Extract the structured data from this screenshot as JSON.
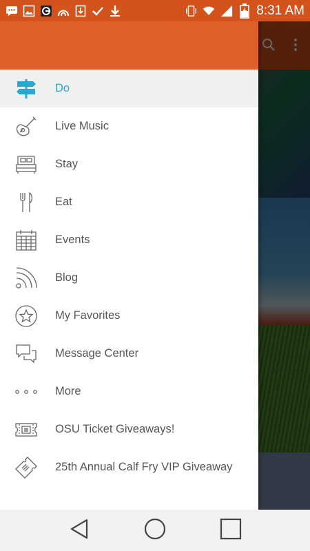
{
  "status_bar": {
    "time": "8:31 AM",
    "left_icons": [
      "messenger-icon",
      "image-icon",
      "app-icon",
      "assistant-icon",
      "download-box-icon",
      "check-icon",
      "download-icon"
    ],
    "right_icons": [
      "vibrate-icon",
      "wifi-icon",
      "signal-icon",
      "battery-charging-icon"
    ]
  },
  "menu": {
    "items": [
      {
        "label": "Do",
        "icon": "signpost-icon",
        "active": true
      },
      {
        "label": "Live Music",
        "icon": "guitar-icon",
        "active": false
      },
      {
        "label": "Stay",
        "icon": "bed-icon",
        "active": false
      },
      {
        "label": "Eat",
        "icon": "fork-knife-icon",
        "active": false
      },
      {
        "label": "Events",
        "icon": "calendar-icon",
        "active": false
      },
      {
        "label": "Blog",
        "icon": "rss-icon",
        "active": false
      },
      {
        "label": "My Favorites",
        "icon": "star-icon",
        "active": false
      },
      {
        "label": "Message Center",
        "icon": "chat-bubbles-icon",
        "active": false
      },
      {
        "label": "More",
        "icon": "more-dots-icon",
        "active": false
      },
      {
        "label": "OSU Ticket Giveaways!",
        "icon": "ticket-icon",
        "active": false
      },
      {
        "label": "25th Annual Calf Fry VIP Giveaway",
        "icon": "ticket-tilted-icon",
        "active": false
      }
    ]
  },
  "colors": {
    "status_bar": "#d4521b",
    "drawer_header": "#e0602a",
    "active_text": "#29a9cf",
    "item_text": "#555555"
  }
}
